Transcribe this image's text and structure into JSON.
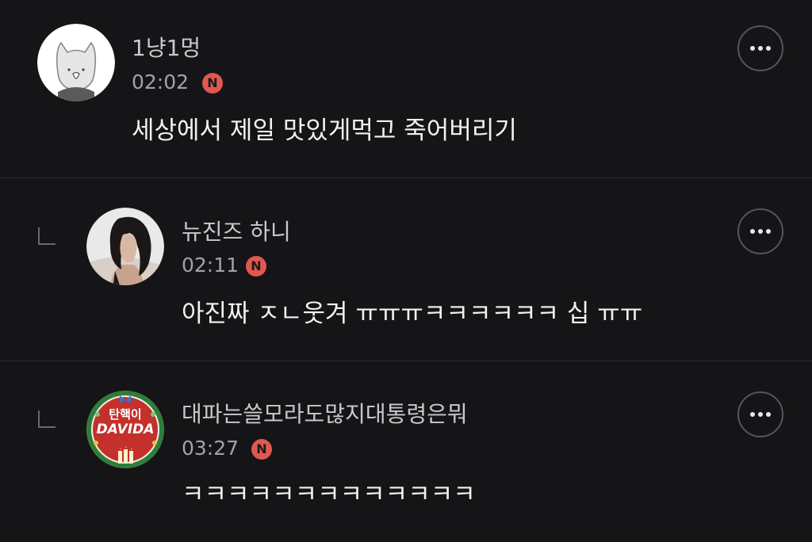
{
  "comments": [
    {
      "author": "1냥1멍",
      "time": "02:02",
      "badge": "N",
      "text": "세상에서 제일 맛있게먹고 죽어버리기",
      "avatar_icon": "cat-avatar-icon",
      "is_reply": false
    },
    {
      "author": "뉴진즈 하니",
      "time": "02:11",
      "badge": "N",
      "text": "아진짜 ㅈㄴ웃겨 ㅠㅠㅠㅋㅋㅋㅋㅋㅋ 십 ㅠㅠ",
      "avatar_icon": "person-photo-avatar-icon",
      "is_reply": true
    },
    {
      "author": "대파는쓸모라도많지대통령은뭐",
      "time": "03:27",
      "badge": "N",
      "text": "ㅋㅋㅋㅋㅋㅋㅋㅋㅋㅋㅋㅋㅋ",
      "avatar_icon": "wreath-avatar-icon",
      "avatar_text_top": "탄핵이",
      "avatar_text_main": "DAVIDA",
      "is_reply": true
    }
  ],
  "colors": {
    "background": "#151517",
    "badge": "#e0584f",
    "text_primary": "#f2f2f3",
    "text_secondary": "#a3a3a7"
  }
}
